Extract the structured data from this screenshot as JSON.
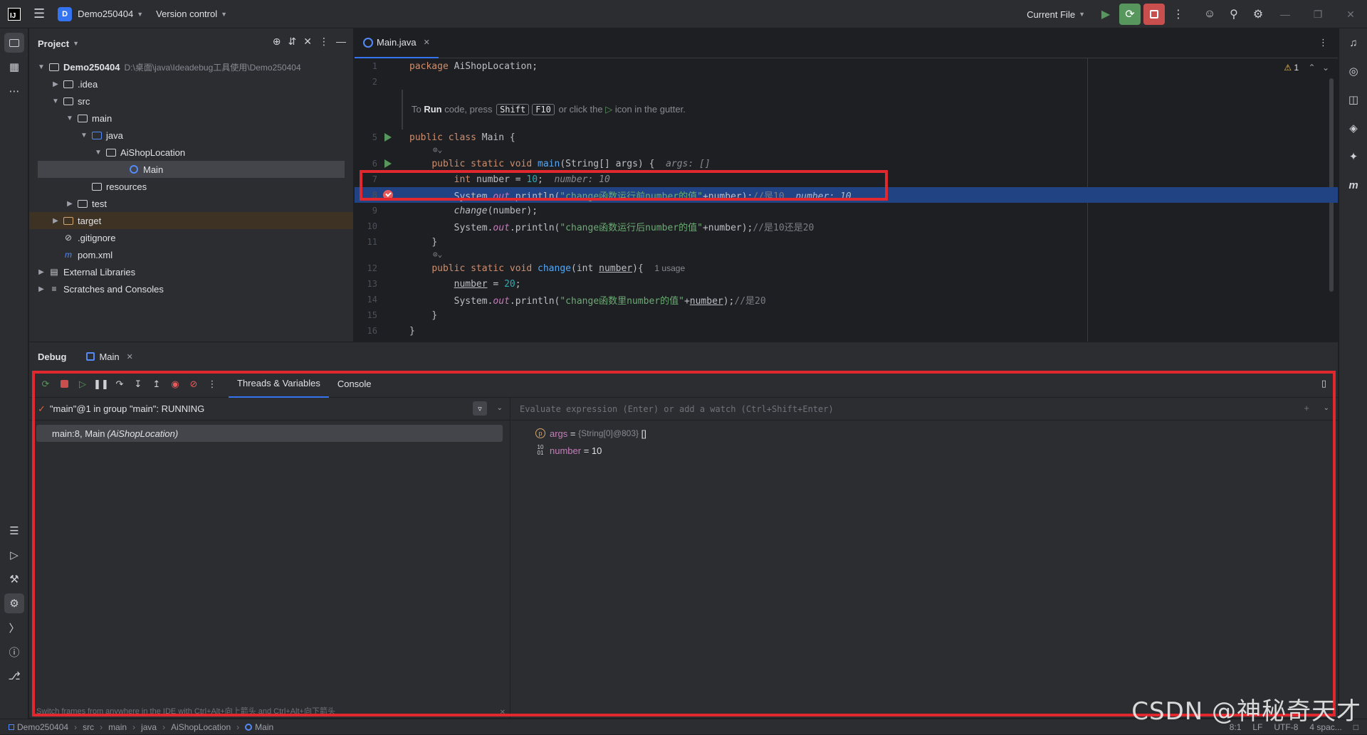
{
  "titlebar": {
    "project_badge": "D",
    "project_name": "Demo250404",
    "vcs": "Version control",
    "run_config": "Current File"
  },
  "project_panel": {
    "title": "Project",
    "root": {
      "name": "Demo250404",
      "path": "D:\\桌面\\java\\Ideadebug工具使用\\Demo250404"
    },
    "items": [
      {
        "label": ".idea"
      },
      {
        "label": "src"
      },
      {
        "label": "main"
      },
      {
        "label": "java"
      },
      {
        "label": "AiShopLocation"
      },
      {
        "label": "Main"
      },
      {
        "label": "resources"
      },
      {
        "label": "test"
      },
      {
        "label": "target"
      },
      {
        "label": ".gitignore"
      },
      {
        "label": "pom.xml"
      },
      {
        "label": "External Libraries"
      },
      {
        "label": "Scratches and Consoles"
      }
    ]
  },
  "editor": {
    "tab": "Main.java",
    "warnings": "1",
    "tip": {
      "pre": "To ",
      "run": "Run",
      "mid": " code, press ",
      "k1": "Shift",
      "k2": "F10",
      "post1": " or click the ",
      "post2": " icon in the gutter."
    },
    "line_numbers": [
      "1",
      "2",
      "5",
      "6",
      "7",
      "8",
      "9",
      "10",
      "11",
      "12",
      "13",
      "14",
      "15",
      "16"
    ],
    "usage_hint": "1 usage",
    "args_hint": "args: []",
    "number_hint": "number: 10",
    "number_hint2": "number: 10"
  },
  "code": {
    "l1_kw": "package",
    "l1_rest": " AiShopLocation;",
    "l5_a": "public class ",
    "l5_b": "Main {",
    "l6_a": "public static void ",
    "l6_b": "main",
    "l6_c": "(String[] args) {",
    "l7_a": "int ",
    "l7_b": "number = ",
    "l7_c": "10",
    "l7_d": ";",
    "l8_a": "System.",
    "l8_b": "out",
    "l8_c": ".println(",
    "l8_d": "\"change函数运行前number的值\"",
    "l8_e": "+number);",
    "l8_f": "//是10",
    "l9_a": "change",
    "l9_b": "(number);",
    "l10_a": "System.",
    "l10_b": "out",
    "l10_c": ".println(",
    "l10_d": "\"change函数运行后number的值\"",
    "l10_e": "+number);",
    "l10_f": "//是10还是20",
    "l11": "}",
    "l12_a": "public static void ",
    "l12_b": "change",
    "l12_c": "(int ",
    "l12_d": "number",
    "l12_e": "){",
    "l13_a": "number",
    "l13_b": " = ",
    "l13_c": "20",
    "l13_d": ";",
    "l14_a": "System.",
    "l14_b": "out",
    "l14_c": ".println(",
    "l14_d": "\"change函数里number的值\"",
    "l14_e": "+",
    "l14_f": "number",
    "l14_g": ");",
    "l14_h": "//是20",
    "l15": "}",
    "l16": "}"
  },
  "debug": {
    "title": "Debug",
    "session_tab": "Main",
    "subtabs": [
      "Threads & Variables",
      "Console"
    ],
    "thread": "\"main\"@1 in group \"main\": RUNNING",
    "frame": {
      "method": "main:8, Main ",
      "class": "(AiShopLocation)"
    },
    "frames_tip": "Switch frames from anywhere in the IDE with Ctrl+Alt+向上箭头 and Ctrl+Alt+向下箭头",
    "eval_placeholder": "Evaluate expression (Enter) or add a watch (Ctrl+Shift+Enter)",
    "variables": [
      {
        "name": "args",
        "eq": " = ",
        "meta": "{String[0]@803}",
        "value": " []"
      },
      {
        "name": "number",
        "eq": " = ",
        "meta": "",
        "value": "10"
      }
    ]
  },
  "statusbar": {
    "crumbs": [
      "Demo250404",
      "src",
      "main",
      "java",
      "AiShopLocation",
      "Main"
    ],
    "position": "8:1",
    "line_sep": "LF",
    "encoding": "UTF-8",
    "indent": "4 spac..."
  },
  "watermark": "CSDN @神秘奇天才",
  "colors": {
    "accent": "#3574f0",
    "highlight_box": "#e0282e",
    "current_line": "#214283"
  }
}
